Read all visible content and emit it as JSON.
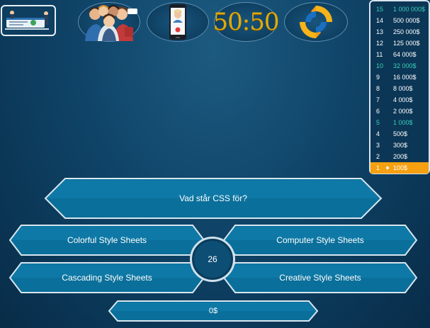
{
  "lifelines": {
    "fifty_fifty": "50:50"
  },
  "ladder": [
    {
      "level": "15",
      "amount": "1 000 000$",
      "safe": true
    },
    {
      "level": "14",
      "amount": "500 000$",
      "safe": false
    },
    {
      "level": "13",
      "amount": "250 000$",
      "safe": false
    },
    {
      "level": "12",
      "amount": "125 000$",
      "safe": false
    },
    {
      "level": "11",
      "amount": "64 000$",
      "safe": false
    },
    {
      "level": "10",
      "amount": "32 000$",
      "safe": true
    },
    {
      "level": "9",
      "amount": "16 000$",
      "safe": false
    },
    {
      "level": "8",
      "amount": "8 000$",
      "safe": false
    },
    {
      "level": "7",
      "amount": "4 000$",
      "safe": false
    },
    {
      "level": "6",
      "amount": "2 000$",
      "safe": false
    },
    {
      "level": "5",
      "amount": "1 000$",
      "safe": true
    },
    {
      "level": "4",
      "amount": "500$",
      "safe": false
    },
    {
      "level": "3",
      "amount": "300$",
      "safe": false
    },
    {
      "level": "2",
      "amount": "200$",
      "safe": false
    },
    {
      "level": "1",
      "amount": "100$",
      "safe": false,
      "current": true
    }
  ],
  "question": "Vad står CSS för?",
  "answers": {
    "a": "Colorful Style Sheets",
    "b": "Computer Style Sheets",
    "c": "Cascading Style Sheets",
    "d": "Creative Style Sheets"
  },
  "timer": "26",
  "score": "0$",
  "colors": {
    "accent_gold": "#e0a90a",
    "safe_level": "#38d0b8",
    "current_level": "#f5a010",
    "button_fill": "#0a6f9a"
  }
}
